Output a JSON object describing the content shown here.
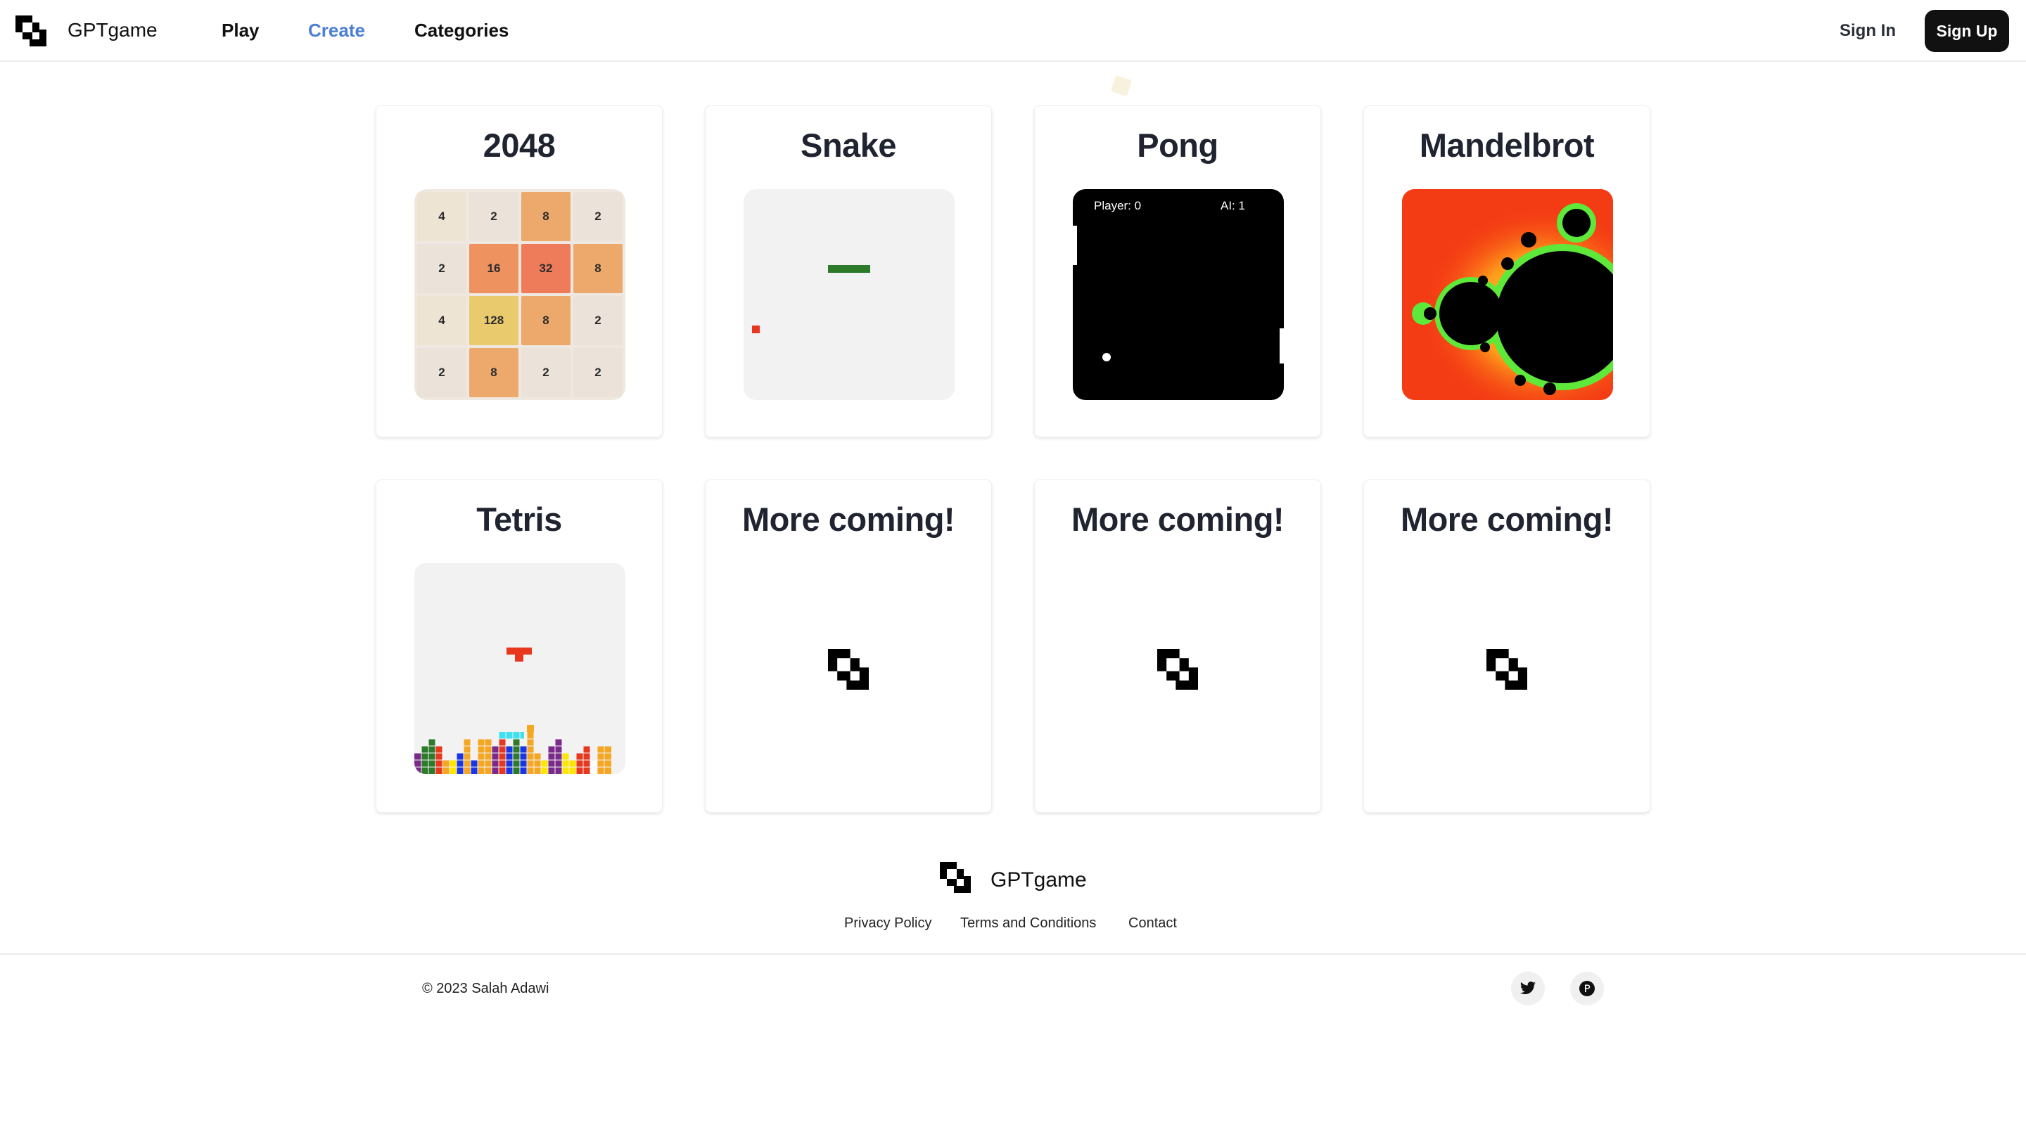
{
  "header": {
    "brand": "GPTgame",
    "nav": [
      {
        "label": "Play",
        "active": false
      },
      {
        "label": "Create",
        "active": true
      },
      {
        "label": "Categories",
        "active": false
      }
    ],
    "sign_in": "Sign In",
    "sign_up": "Sign Up"
  },
  "games": [
    {
      "title": "2048"
    },
    {
      "title": "Snake"
    },
    {
      "title": "Pong"
    },
    {
      "title": "Mandelbrot"
    },
    {
      "title": "Tetris"
    },
    {
      "title": "More coming!"
    },
    {
      "title": "More coming!"
    },
    {
      "title": "More coming!"
    }
  ],
  "board_2048": [
    [
      "4",
      "2",
      "8",
      "2"
    ],
    [
      "2",
      "16",
      "32",
      "8"
    ],
    [
      "4",
      "128",
      "8",
      "2"
    ],
    [
      "2",
      "8",
      "2",
      "2"
    ]
  ],
  "pong": {
    "player_score": "Player: 0",
    "ai_score": "AI: 1"
  },
  "footer": {
    "brand": "GPTgame",
    "links": [
      "Privacy Policy",
      "Terms and Conditions",
      "Contact"
    ],
    "copyright": "© 2023 Salah Adawi",
    "social_icons": [
      "twitter-icon",
      "producthunt-icon"
    ]
  },
  "colors": {
    "accent_link": "#4a7fd4",
    "primary_button": "#111111",
    "snake_green": "#2d7a2a",
    "snake_food": "#e8371f",
    "mandelbrot_bg": "#f43c14"
  },
  "icons": {
    "logo": "gptgame-logo-icon"
  }
}
